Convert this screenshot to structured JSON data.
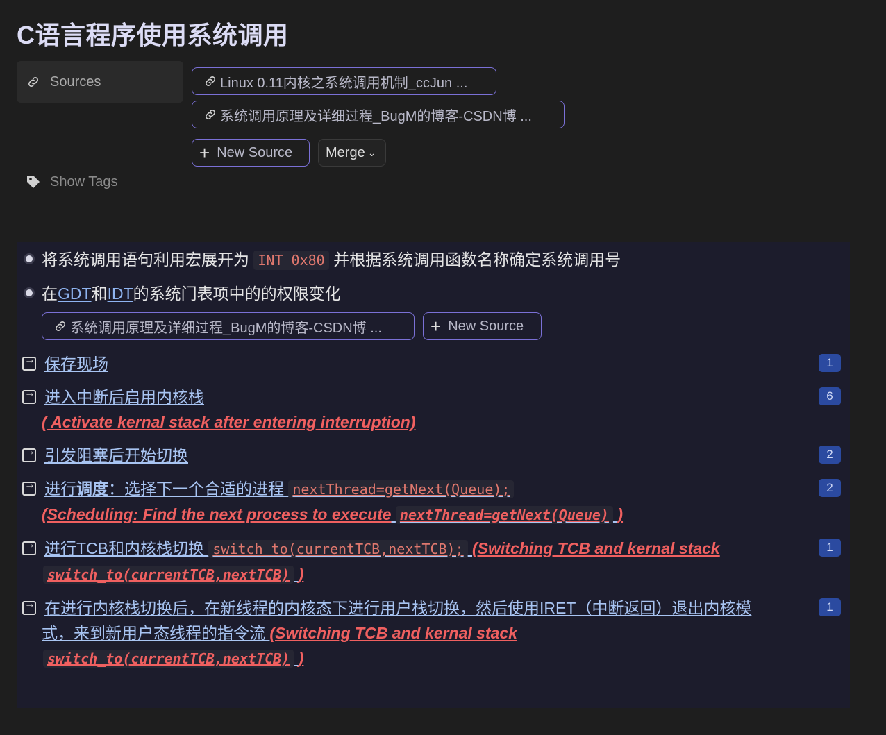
{
  "page": {
    "title": "C语言程序使用系统调用"
  },
  "properties": {
    "sources_label": "Sources",
    "tags_label": "Show Tags",
    "sources": [
      "Linux 0.11内核之系统调用机制_ccJun ...",
      "系统调用原理及详细过程_BugM的博客-CSDN博 ..."
    ],
    "new_source_label": "New Source",
    "merge_label": "Merge"
  },
  "bullets": [
    {
      "prefix": "将系统调用语句利用宏展开为",
      "code": "INT 0x80",
      "suffix": "并根据系统调用函数名称确定系统调用号"
    },
    {
      "t1": "在",
      "link1": "GDT",
      "t2": "和",
      "link2": "IDT",
      "t3": "的系统门表项中的的权限变化",
      "source": "系统调用原理及详细过程_BugM的博客-CSDN博 ...",
      "new_source_label": "New Source"
    }
  ],
  "refs": [
    {
      "text": "保存现场",
      "count": "1"
    },
    {
      "text": "进入中断后启用内核栈",
      "note": "( Activate kernal stack after entering interruption)",
      "count": "6"
    },
    {
      "text": "引发阻塞后开始切换",
      "count": "2"
    },
    {
      "text_a": "进行",
      "text_bold": "调度",
      "text_b": "：选择下一个合适的进程",
      "code": "nextThread=getNext(Queue);",
      "note": "(Scheduling: Find the next process to execute",
      "note_code": "nextThread=getNext(Queue)",
      "note_end": ")",
      "count": "2"
    },
    {
      "text": "进行TCB和内核栈切换",
      "code": "switch_to(currentTCB,nextTCB);",
      "note": "(Switching TCB and kernal stack",
      "note_code": "switch_to(currentTCB,nextTCB)",
      "note_end": ")",
      "count": "1"
    },
    {
      "text_line1": "在进行内核栈切换后，在新线程的内核态下进行用户栈切换，然后使用IRET（中断返回）退出内核模",
      "text_line2": "式，来到新用户态线程的指令流",
      "note": "(Switching TCB and kernal stack",
      "note_code": "switch_to(currentTCB,nextTCB)",
      "note_end": ")",
      "count": "1"
    }
  ],
  "colors": {
    "accent_border": "#7a70d6",
    "badge": "#2b4aa0",
    "link": "#8fb4f0",
    "red_note": "#f06060"
  },
  "icons": [
    "link-icon",
    "tag-icon",
    "plus-icon",
    "chevron-down-icon",
    "reference-arrow-icon",
    "bullet-icon"
  ]
}
